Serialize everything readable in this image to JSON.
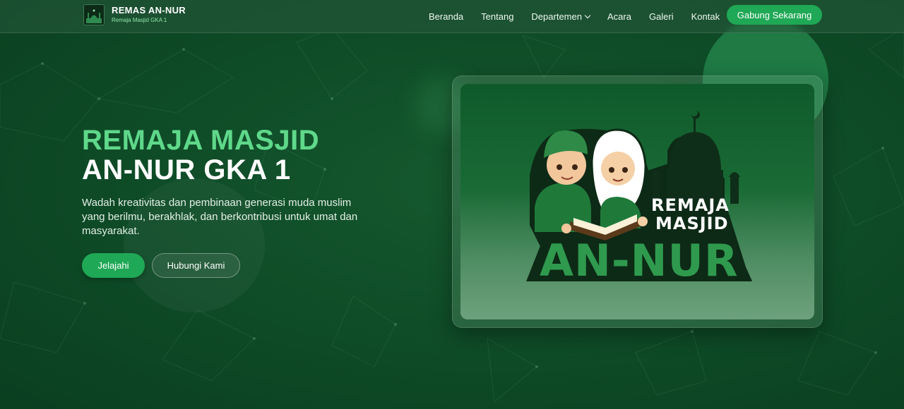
{
  "brand": {
    "name": "REMAS AN-NUR",
    "subtitle": "Remaja Masjid GKA 1"
  },
  "nav": {
    "items": [
      {
        "label": "Beranda"
      },
      {
        "label": "Tentang"
      },
      {
        "label": "Departemen",
        "has_dropdown": true
      },
      {
        "label": "Acara"
      },
      {
        "label": "Galeri"
      },
      {
        "label": "Kontak"
      }
    ],
    "cta": "Gabung Sekarang"
  },
  "hero": {
    "title_line1": "REMAJA MASJID",
    "title_line2": "AN-NUR GKA 1",
    "description": "Wadah kreativitas dan pembinaan generasi muda muslim yang berilmu, berakhlak, dan berkontribusi untuk umat dan masyarakat.",
    "primary_button": "Jelajahi",
    "secondary_button": "Hubungi Kami"
  },
  "logo_art": {
    "line1": "REMAJA",
    "line2": "MASJID",
    "line3": "AN-NUR"
  },
  "colors": {
    "accent": "#1fa855",
    "title_green": "#5fd88a",
    "background": "#0d4a26"
  },
  "icons": {
    "dropdown": "chevron-down-icon",
    "logo": "mosque-logo-icon"
  }
}
